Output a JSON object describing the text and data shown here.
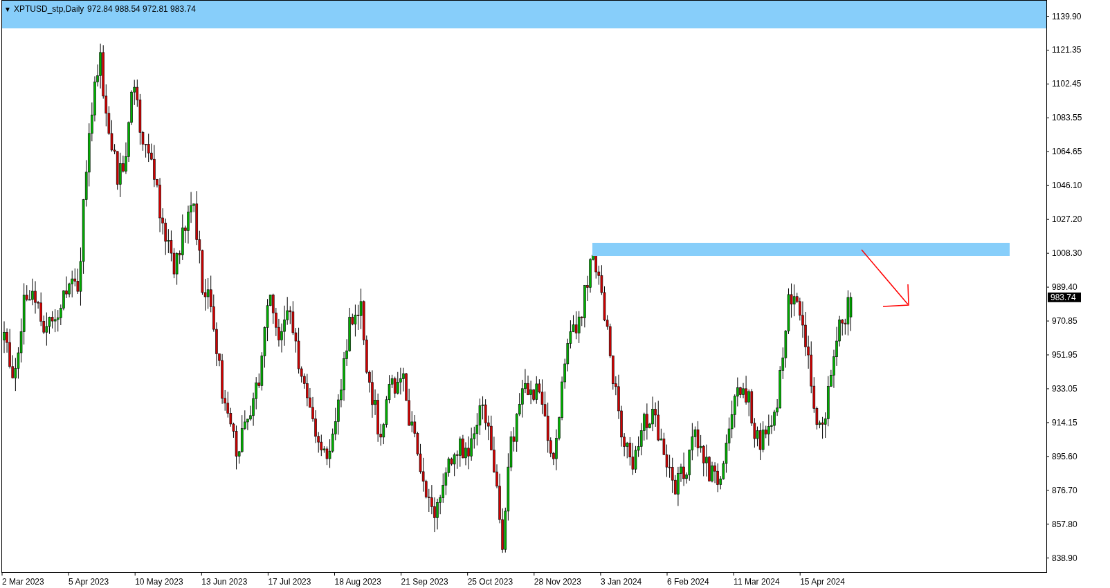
{
  "header": {
    "collapse_glyph": "▼",
    "symbol": "XPTUSD_stp,Daily",
    "ohlc": "972.84 988.54 972.81 983.74"
  },
  "price_axis": {
    "ticks": [
      "1139.90",
      "1121.35",
      "1102.45",
      "1083.55",
      "1064.65",
      "1046.10",
      "1027.20",
      "1008.30",
      "989.40",
      "970.85",
      "951.95",
      "933.05",
      "914.15",
      "895.60",
      "876.70",
      "857.80",
      "838.90"
    ],
    "current_price": "983.74"
  },
  "time_axis": {
    "labels": [
      "2 Mar 2023",
      "5 Apr 2023",
      "10 May 2023",
      "13 Jun 2023",
      "17 Jul 2023",
      "18 Aug 2023",
      "21 Sep 2023",
      "25 Oct 2023",
      "28 Nov 2023",
      "3 Jan 2024",
      "6 Feb 2024",
      "11 Mar 2024",
      "15 Apr 2024"
    ]
  }
}
